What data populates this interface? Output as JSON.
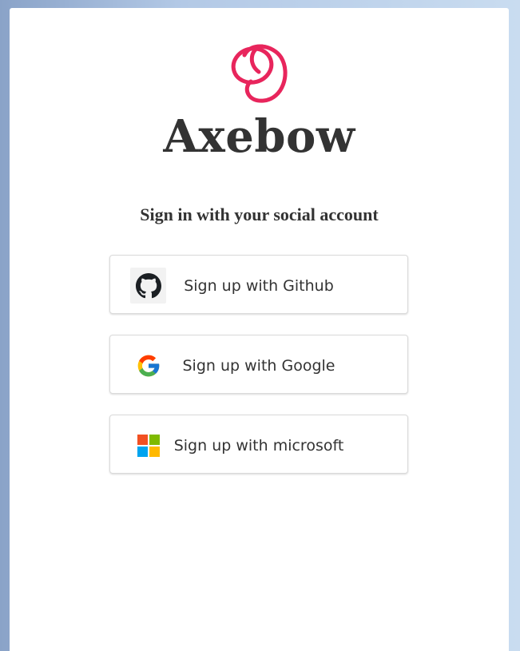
{
  "brand": {
    "name": "Axebow",
    "logo_icon": "axebow-logo-icon",
    "logo_color": "#e8255c"
  },
  "signin": {
    "heading": "Sign in with your social account",
    "buttons": [
      {
        "label": "Sign up with Github",
        "icon": "github-icon"
      },
      {
        "label": "Sign up with Google",
        "icon": "google-icon"
      },
      {
        "label": "Sign up with microsoft",
        "icon": "microsoft-icon"
      }
    ]
  }
}
